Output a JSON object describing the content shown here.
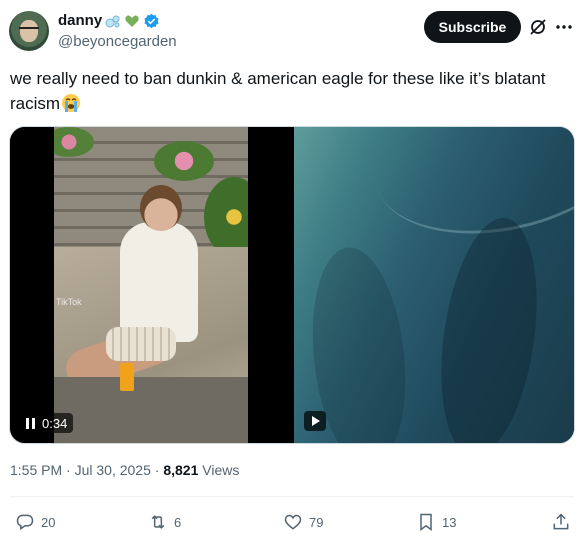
{
  "user": {
    "display_name": "danny",
    "handle": "@beyoncegarden",
    "verified": true
  },
  "header": {
    "subscribe_label": "Subscribe",
    "icons": [
      "bubbles-emoji",
      "green-heart-emoji",
      "verified-badge-icon",
      "grok-icon",
      "more-icon"
    ]
  },
  "tweet": {
    "text": "we really need to ban dunkin & american eagle for these like it’s blatant racism",
    "trailing_emoji": "loudly-crying-face-emoji"
  },
  "media": {
    "video1": {
      "time": "0:34",
      "watermark": "TikTok"
    },
    "video2": {
      "control": "play-icon"
    }
  },
  "meta": {
    "time": "1:55 PM",
    "separator": " · ",
    "date": "Jul 30, 2025",
    "views_count": "8,821",
    "views_label": "Views"
  },
  "actions": {
    "replies": "20",
    "reposts": "6",
    "likes": "79",
    "bookmarks": "13"
  },
  "colors": {
    "text_primary": "#0f1419",
    "text_secondary": "#536471",
    "verified_blue": "#1d9bf0",
    "subscribe_bg": "#0f1419"
  }
}
